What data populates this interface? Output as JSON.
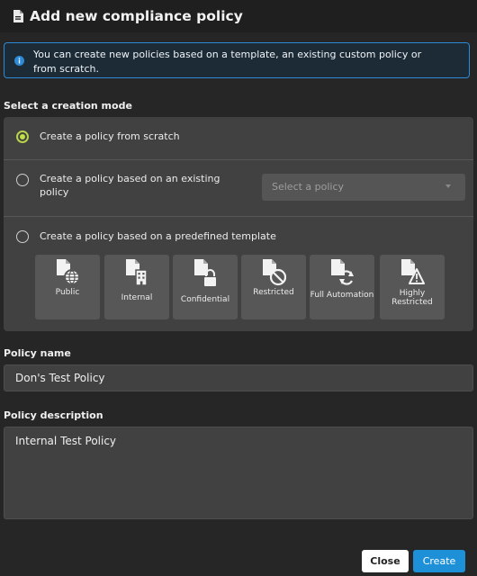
{
  "dialog": {
    "title": "Add new compliance policy",
    "title_icon": "document-icon"
  },
  "info": {
    "icon": "info-icon",
    "text": "You can create new policies based on a template, an existing custom policy or from scratch."
  },
  "creation_mode": {
    "label": "Select a creation mode",
    "options": [
      {
        "label": "Create a policy from scratch",
        "selected": true
      },
      {
        "label": "Create a policy based on an existing policy",
        "selected": false
      },
      {
        "label": "Create a policy based on a predefined template",
        "selected": false
      }
    ],
    "existing_policy_select": {
      "placeholder": "Select a policy"
    },
    "templates": [
      {
        "label": "Public",
        "icon": "document-globe-icon"
      },
      {
        "label": "Internal",
        "icon": "document-building-icon"
      },
      {
        "label": "Confidential",
        "icon": "document-lock-icon"
      },
      {
        "label": "Restricted",
        "icon": "document-ban-icon"
      },
      {
        "label": "Full Automation",
        "icon": "document-refresh-icon"
      },
      {
        "label": "Highly Restricted",
        "icon": "document-warning-icon"
      }
    ]
  },
  "policy_name": {
    "label": "Policy name",
    "value": "Don's Test Policy"
  },
  "policy_description": {
    "label": "Policy description",
    "value": "Internal Test Policy"
  },
  "buttons": {
    "close": "Close",
    "create": "Create"
  },
  "colors": {
    "accent": "#1e90d8",
    "radio_selected": "#c2e048",
    "background": "#262626",
    "panel": "#414141"
  }
}
